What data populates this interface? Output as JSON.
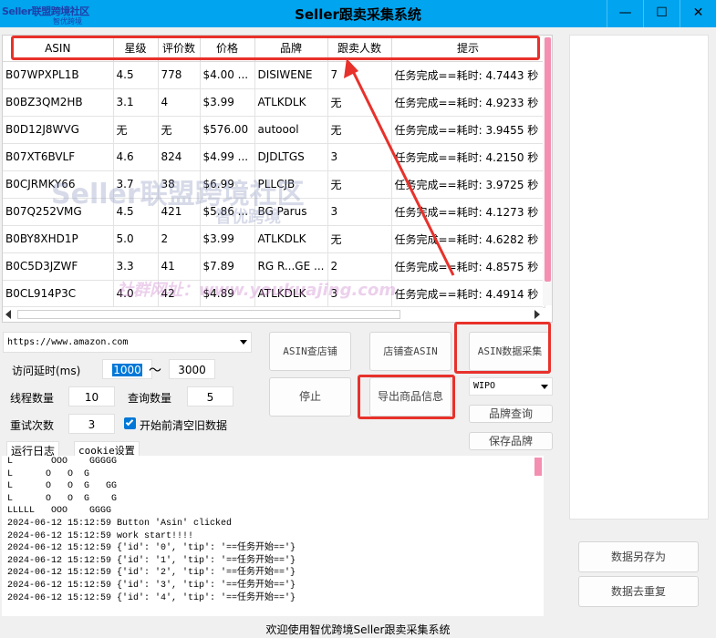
{
  "window": {
    "logo_line1": "Seller联盟跨境社区",
    "logo_line2": "智优跨境",
    "title": "Seller跟卖采集系统",
    "minimize": "—",
    "maximize": "☐",
    "close": "✕"
  },
  "table": {
    "columns": [
      "ASIN",
      "星级",
      "评价数",
      "价格",
      "品牌",
      "跟卖人数",
      "提示"
    ],
    "rows": [
      [
        "B07WPXPL1B",
        "4.5",
        "778",
        "$4.00 ...",
        "DISIWENE",
        "7",
        "任务完成==耗时: 4.7443 秒"
      ],
      [
        "B0BZ3QM2HB",
        "3.1",
        "4",
        "$3.99",
        "ATLKDLK",
        "无",
        "任务完成==耗时: 4.9233 秒"
      ],
      [
        "B0D12J8WVG",
        "无",
        "无",
        "$576.00",
        "autoool",
        "无",
        "任务完成==耗时: 3.9455 秒"
      ],
      [
        "B07XT6BVLF",
        "4.6",
        "824",
        "$4.99 ...",
        "DJDLTGS",
        "3",
        "任务完成==耗时: 4.2150 秒"
      ],
      [
        "B0CJRMKY66",
        "3.7",
        "38",
        "$6.99",
        "PLLCJB",
        "无",
        "任务完成==耗时: 3.9725 秒"
      ],
      [
        "B07Q252VMG",
        "4.5",
        "421",
        "$5.86 ...",
        "BG Parus",
        "3",
        "任务完成==耗时: 4.1273 秒"
      ],
      [
        "B0BY8XHD1P",
        "5.0",
        "2",
        "$3.99",
        "ATLKDLK",
        "无",
        "任务完成==耗时: 4.6282 秒"
      ],
      [
        "B0C5D3JZWF",
        "3.3",
        "41",
        "$7.89",
        "RG R...GE ...",
        "2",
        "任务完成==耗时: 4.8575 秒"
      ],
      [
        "B0CL914P3C",
        "4.0",
        "42",
        "$4.89",
        "ATLKDLK",
        "3",
        "任务完成==耗时: 4.4914 秒"
      ]
    ]
  },
  "controls": {
    "url": "https://www.amazon.com",
    "delay_label": "访问延时(ms)",
    "delay_min": "1000",
    "tilde": "～",
    "delay_max": "3000",
    "threads_label": "线程数量",
    "threads": "10",
    "query_label": "查询数量",
    "query": "5",
    "retry_label": "重试次数",
    "retry": "3",
    "clear_label": "开始前清空旧数据",
    "btn_asin_shop": "ASIN查店铺",
    "btn_shop_asin": "店铺查ASIN",
    "btn_asin_collect": "ASIN数据采集",
    "btn_stop": "停止",
    "btn_export": "导出商品信息",
    "wipo": "WIPO",
    "btn_brand_query": "品牌查询",
    "btn_save_brand": "保存品牌",
    "btn_save_as": "数据另存为",
    "btn_dedupe": "数据去重复"
  },
  "tabs": {
    "log": "运行日志",
    "cookie": "cookie设置"
  },
  "log": [
    "L       OOO    GGGGG",
    "L      O   O  G",
    "L      O   O  G   GG",
    "L      O   O  G    G",
    "LLLLL   OOO    GGGG",
    "2024-06-12 15:12:59 Button 'Asin' clicked",
    "2024-06-12 15:12:59 work start!!!!",
    "2024-06-12 15:12:59 {'id': '0', 'tip': '==任务开始=='}",
    "2024-06-12 15:12:59 {'id': '1', 'tip': '==任务开始=='}",
    "2024-06-12 15:12:59 {'id': '2', 'tip': '==任务开始=='}",
    "2024-06-12 15:12:59 {'id': '3', 'tip': '==任务开始=='}",
    "2024-06-12 15:12:59 {'id': '4', 'tip': '==任务开始=='}"
  ],
  "status": "欢迎使用智优跨境Seller跟卖采集系统",
  "watermark": {
    "big": "Seller联盟跨境社区",
    "sub": "智优跨境",
    "url": "社群网址：www.youkuajing.com"
  },
  "colors": {
    "titlebar": "#00a4ef",
    "highlight": "#e8312b",
    "scrollbar_thumb": "#f48fb1"
  }
}
